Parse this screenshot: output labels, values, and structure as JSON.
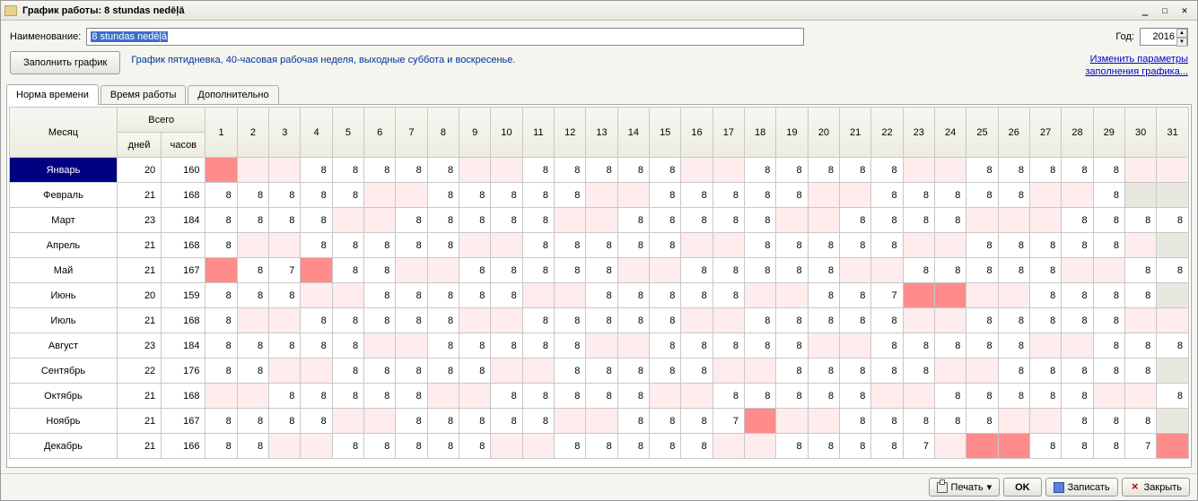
{
  "window": {
    "title": "График работы: 8 stundas nedēļā"
  },
  "labels": {
    "name": "Наименование:",
    "year": "Год:",
    "fill": "Заполнить график",
    "desc": "График пятидневка, 40-часовая рабочая неделя, выходные суббота и воскресенье.",
    "link1": "Изменить параметры",
    "link2": "заполнения графика..."
  },
  "name_value": "8 stundas nedēļā",
  "year_value": "2016",
  "tabs": [
    "Норма времени",
    "Время работы",
    "Дополнительно"
  ],
  "headers": {
    "month": "Месяц",
    "total": "Всего",
    "days": "дней",
    "hours": "часов"
  },
  "day_cols": [
    "1",
    "2",
    "3",
    "4",
    "5",
    "6",
    "7",
    "8",
    "9",
    "10",
    "11",
    "12",
    "13",
    "14",
    "15",
    "16",
    "17",
    "18",
    "19",
    "20",
    "21",
    "22",
    "23",
    "24",
    "25",
    "26",
    "27",
    "28",
    "29",
    "30",
    "31"
  ],
  "footer": {
    "print": "Печать",
    "ok": "OK",
    "save": "Записать",
    "close": "Закрыть"
  },
  "chart_data": {
    "type": "table",
    "title": "Норма времени 2016",
    "columns": [
      "Месяц",
      "дней",
      "часов",
      "1",
      "2",
      "3",
      "4",
      "5",
      "6",
      "7",
      "8",
      "9",
      "10",
      "11",
      "12",
      "13",
      "14",
      "15",
      "16",
      "17",
      "18",
      "19",
      "20",
      "21",
      "22",
      "23",
      "24",
      "25",
      "26",
      "27",
      "28",
      "29",
      "30",
      "31"
    ],
    "rows": [
      {
        "month": "Январь",
        "days": 20,
        "hours": 160,
        "cells": [
          "H",
          "",
          "",
          "8",
          "8",
          "8",
          "8",
          "8",
          "",
          "",
          "8",
          "8",
          "8",
          "8",
          "8",
          "",
          "",
          "8",
          "8",
          "8",
          "8",
          "8",
          "",
          "",
          "8",
          "8",
          "8",
          "8",
          "8",
          "",
          ""
        ]
      },
      {
        "month": "Февраль",
        "days": 21,
        "hours": 168,
        "cells": [
          "8",
          "8",
          "8",
          "8",
          "8",
          "",
          "",
          "8",
          "8",
          "8",
          "8",
          "8",
          "",
          "",
          "8",
          "8",
          "8",
          "8",
          "8",
          "",
          "",
          "8",
          "8",
          "8",
          "8",
          "8",
          "",
          "",
          "8",
          "X",
          "X"
        ]
      },
      {
        "month": "Март",
        "days": 23,
        "hours": 184,
        "cells": [
          "8",
          "8",
          "8",
          "8",
          "",
          "",
          "8",
          "8",
          "8",
          "8",
          "8",
          "",
          "",
          "8",
          "8",
          "8",
          "8",
          "8",
          "",
          "",
          "8",
          "8",
          "8",
          "8",
          "",
          "",
          "",
          "8",
          "8",
          "8",
          "8"
        ]
      },
      {
        "month": "Апрель",
        "days": 21,
        "hours": 168,
        "cells": [
          "8",
          "",
          "",
          "8",
          "8",
          "8",
          "8",
          "8",
          "",
          "",
          "8",
          "8",
          "8",
          "8",
          "8",
          "",
          "",
          "8",
          "8",
          "8",
          "8",
          "8",
          "",
          "",
          "8",
          "8",
          "8",
          "8",
          "8",
          "",
          "X"
        ]
      },
      {
        "month": "Май",
        "days": 21,
        "hours": 167,
        "cells": [
          "H",
          "8",
          "7",
          "H",
          "8",
          "8",
          "",
          "",
          "8",
          "8",
          "8",
          "8",
          "8",
          "",
          "",
          "8",
          "8",
          "8",
          "8",
          "8",
          "",
          "",
          "8",
          "8",
          "8",
          "8",
          "8",
          "",
          "",
          "8",
          "8"
        ]
      },
      {
        "month": "Июнь",
        "days": 20,
        "hours": 159,
        "cells": [
          "8",
          "8",
          "8",
          "",
          "",
          "8",
          "8",
          "8",
          "8",
          "8",
          "",
          "",
          "8",
          "8",
          "8",
          "8",
          "8",
          "",
          "",
          "8",
          "8",
          "7",
          "H",
          "H",
          "",
          "",
          "8",
          "8",
          "8",
          "8",
          "X"
        ]
      },
      {
        "month": "Июль",
        "days": 21,
        "hours": 168,
        "cells": [
          "8",
          "",
          "",
          "8",
          "8",
          "8",
          "8",
          "8",
          "",
          "",
          "8",
          "8",
          "8",
          "8",
          "8",
          "",
          "",
          "8",
          "8",
          "8",
          "8",
          "8",
          "",
          "",
          "8",
          "8",
          "8",
          "8",
          "8",
          "",
          ""
        ]
      },
      {
        "month": "Август",
        "days": 23,
        "hours": 184,
        "cells": [
          "8",
          "8",
          "8",
          "8",
          "8",
          "",
          "",
          "8",
          "8",
          "8",
          "8",
          "8",
          "",
          "",
          "8",
          "8",
          "8",
          "8",
          "8",
          "",
          "",
          "8",
          "8",
          "8",
          "8",
          "8",
          "",
          "",
          "8",
          "8",
          "8"
        ]
      },
      {
        "month": "Сентябрь",
        "days": 22,
        "hours": 176,
        "cells": [
          "8",
          "8",
          "",
          "",
          "8",
          "8",
          "8",
          "8",
          "8",
          "",
          "",
          "8",
          "8",
          "8",
          "8",
          "8",
          "",
          "",
          "8",
          "8",
          "8",
          "8",
          "8",
          "",
          "",
          "8",
          "8",
          "8",
          "8",
          "8",
          "X"
        ]
      },
      {
        "month": "Октябрь",
        "days": 21,
        "hours": 168,
        "cells": [
          "",
          "",
          "8",
          "8",
          "8",
          "8",
          "8",
          "",
          "",
          "8",
          "8",
          "8",
          "8",
          "8",
          "",
          "",
          "8",
          "8",
          "8",
          "8",
          "8",
          "",
          "",
          "8",
          "8",
          "8",
          "8",
          "8",
          "",
          "",
          "8"
        ]
      },
      {
        "month": "Ноябрь",
        "days": 21,
        "hours": 167,
        "cells": [
          "8",
          "8",
          "8",
          "8",
          "",
          "",
          "8",
          "8",
          "8",
          "8",
          "8",
          "",
          "",
          "8",
          "8",
          "8",
          "7",
          "H",
          "",
          "",
          "8",
          "8",
          "8",
          "8",
          "8",
          "",
          "",
          "8",
          "8",
          "8",
          "X"
        ]
      },
      {
        "month": "Декабрь",
        "days": 21,
        "hours": 166,
        "cells": [
          "8",
          "8",
          "",
          "",
          "8",
          "8",
          "8",
          "8",
          "8",
          "",
          "",
          "8",
          "8",
          "8",
          "8",
          "8",
          "",
          "",
          "8",
          "8",
          "8",
          "8",
          "7",
          "",
          "H",
          "H",
          "8",
          "8",
          "8",
          "7",
          "H"
        ]
      }
    ]
  }
}
